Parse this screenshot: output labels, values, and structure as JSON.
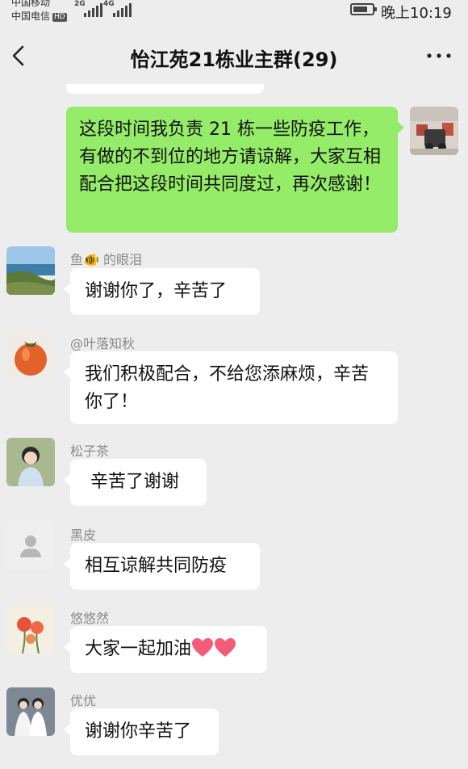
{
  "status_bar": {
    "carrier1": "中国移动",
    "carrier2": "中国电信",
    "hd_badge": "HD",
    "signal1_type": "2G",
    "signal2_type": "4G",
    "time": "晚上10:19"
  },
  "header": {
    "title": "怡江苑21栋业主群(29)"
  },
  "messages": [
    {
      "side": "right",
      "text": "这段时间我负责 21 栋一些防疫工作，有做的不到位的地方请谅解，大家互相配合把这段时间共同度过，再次感谢！"
    },
    {
      "side": "left",
      "sender": "鱼🐠 的眼泪",
      "text": "谢谢你了，辛苦了"
    },
    {
      "side": "left",
      "sender": "@叶落知秋",
      "text": "我们积极配合，不给您添麻烦，辛苦你了！"
    },
    {
      "side": "left",
      "sender": "松子茶",
      "text": " 辛苦了谢谢"
    },
    {
      "side": "left",
      "sender": "黑皮",
      "text": "相互谅解共同防疫"
    },
    {
      "side": "left",
      "sender": "悠悠然",
      "text": "大家一起加油",
      "emoji": "❤️❤️"
    },
    {
      "side": "left",
      "sender": "优优",
      "text": "谢谢你辛苦了"
    }
  ],
  "colors": {
    "background": "#ededed",
    "bubble_self": "#95ec69",
    "bubble_other": "#ffffff",
    "sender_name": "#8a8a8a"
  }
}
